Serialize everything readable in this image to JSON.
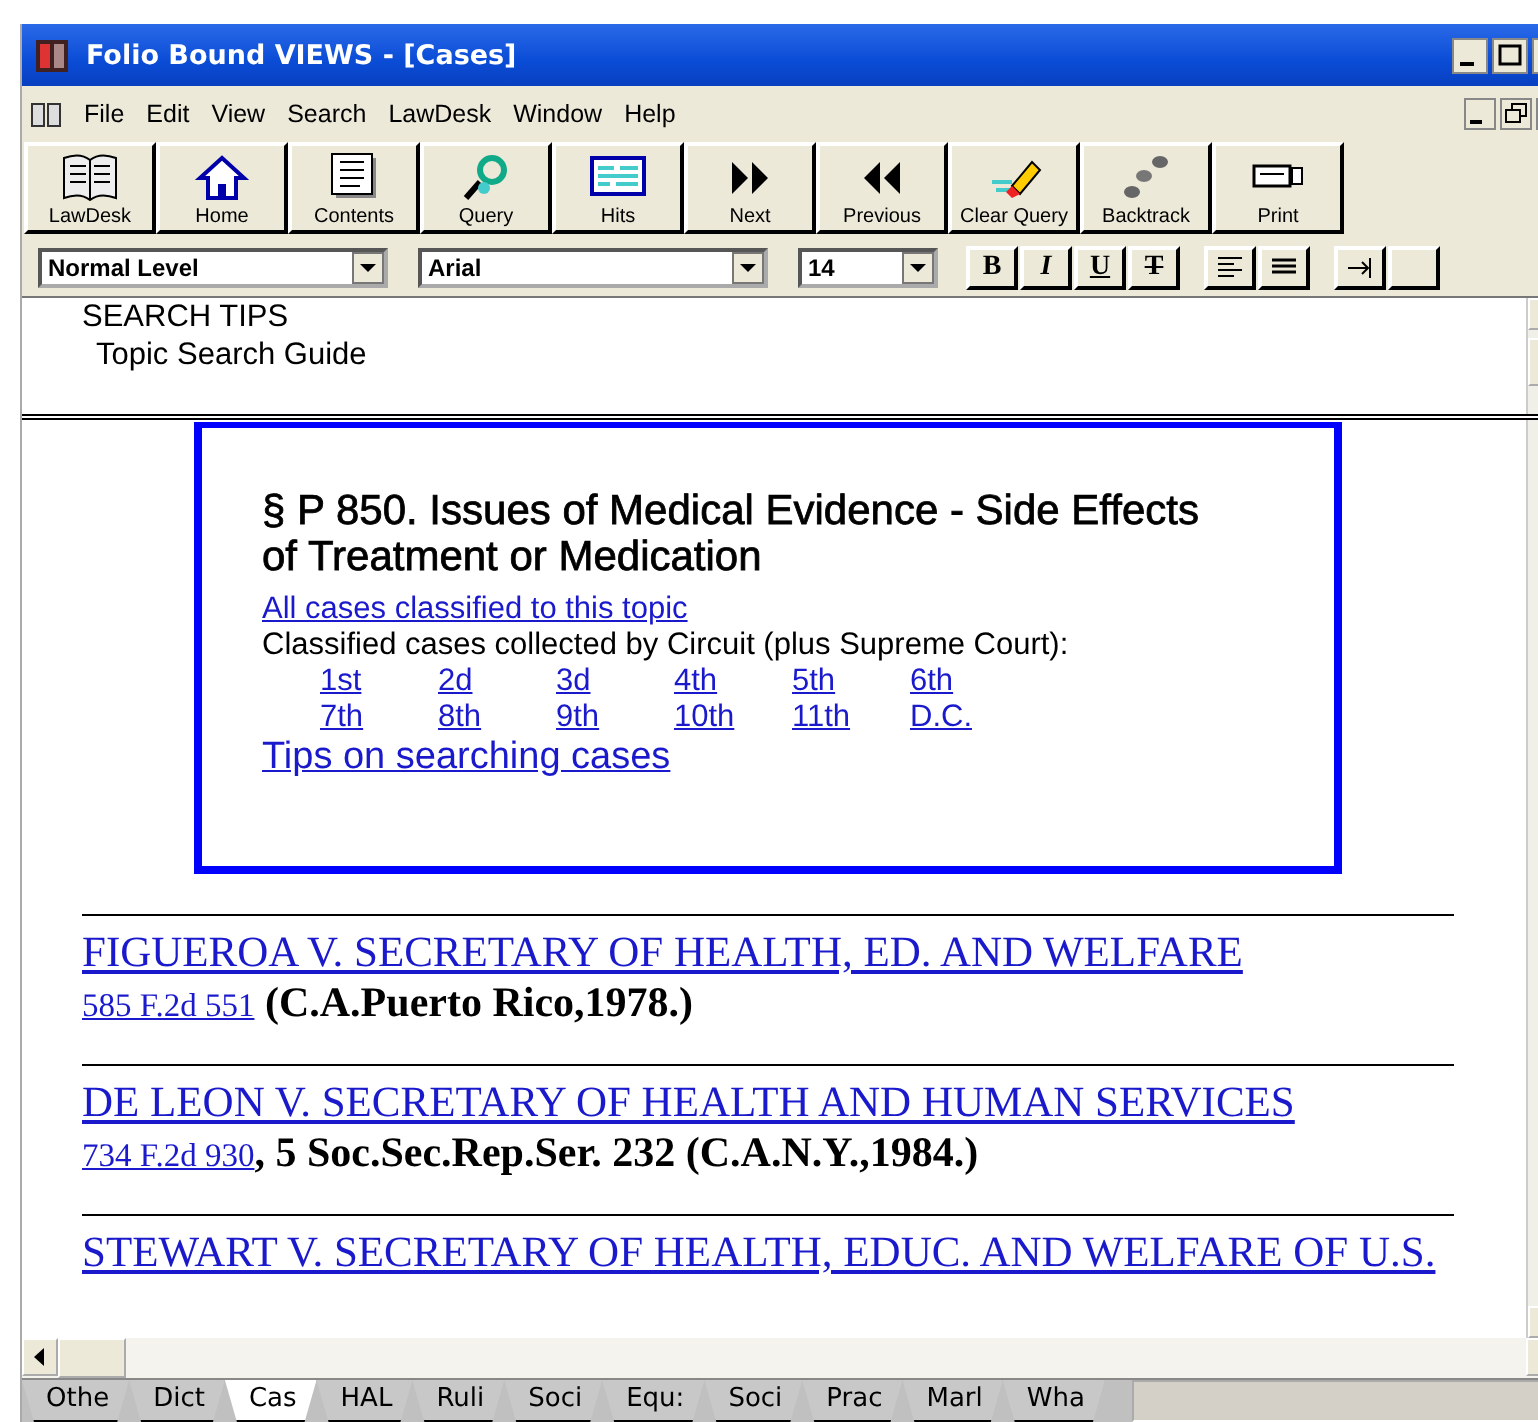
{
  "window": {
    "title": "Folio Bound VIEWS - [Cases]"
  },
  "menu_bar": {
    "items": [
      "File",
      "Edit",
      "View",
      "Search",
      "LawDesk",
      "Window",
      "Help"
    ]
  },
  "toolbar": {
    "buttons": [
      {
        "kind": "lawdesk",
        "label": "LawDesk"
      },
      {
        "kind": "home",
        "label": "Home"
      },
      {
        "kind": "contents",
        "label": "Contents"
      },
      {
        "kind": "query",
        "label": "Query"
      },
      {
        "kind": "hits",
        "label": "Hits"
      },
      {
        "kind": "next",
        "label": "Next"
      },
      {
        "kind": "previous",
        "label": "Previous"
      },
      {
        "kind": "clear",
        "label": "Clear Query"
      },
      {
        "kind": "backtrack",
        "label": "Backtrack"
      },
      {
        "kind": "print",
        "label": "Print"
      }
    ]
  },
  "format_bar": {
    "level_select": "Normal Level",
    "font_select": "Arial",
    "size_select": "14",
    "style_buttons": [
      {
        "kind": "bold",
        "label": "B"
      },
      {
        "kind": "italic",
        "label": "I"
      },
      {
        "kind": "underline",
        "label": "U"
      },
      {
        "kind": "strike",
        "label": "T"
      }
    ]
  },
  "upper_pane": {
    "heading": "SEARCH TIPS",
    "link": "Topic Search Guide"
  },
  "topic_box": {
    "heading": "§ P 850. Issues of Medical Evidence - Side Effects of Treatment or Medication",
    "all_cases_link": "All cases classified to this topic",
    "circuit_note": "Classified cases collected by Circuit (plus Supreme Court):",
    "circuits": [
      [
        "1st",
        "2d",
        "3d",
        "4th",
        "5th",
        "6th"
      ],
      [
        "7th",
        "8th",
        "9th",
        "10th",
        "11th",
        "D.C."
      ]
    ],
    "tips_link": "Tips on searching cases"
  },
  "cases": [
    {
      "title": "FIGUEROA V. SECRETARY OF HEALTH, ED. AND WELFARE",
      "citation_link": "585 F.2d 551",
      "citation_rest": " (C.A.Puerto Rico,1978.)"
    },
    {
      "title": "DE LEON V. SECRETARY OF HEALTH AND HUMAN SERVICES",
      "citation_link": "734 F.2d 930",
      "citation_rest": ", 5 Soc.Sec.Rep.Ser. 232 (C.A.N.Y.,1984.)"
    },
    {
      "title": "STEWART V. SECRETARY OF HEALTH, EDUC. AND WELFARE OF U.S."
    }
  ],
  "tabs": [
    {
      "label": "Othe",
      "selected": false
    },
    {
      "label": "Dict",
      "selected": false
    },
    {
      "label": "Cas",
      "selected": true
    },
    {
      "label": "HAL",
      "selected": false
    },
    {
      "label": "Ruli",
      "selected": false
    },
    {
      "label": "Soci",
      "selected": false
    },
    {
      "label": "Equ:",
      "selected": false
    },
    {
      "label": "Soci",
      "selected": false
    },
    {
      "label": "Prac",
      "selected": false
    },
    {
      "label": "Marl",
      "selected": false
    },
    {
      "label": "Wha",
      "selected": false
    }
  ]
}
